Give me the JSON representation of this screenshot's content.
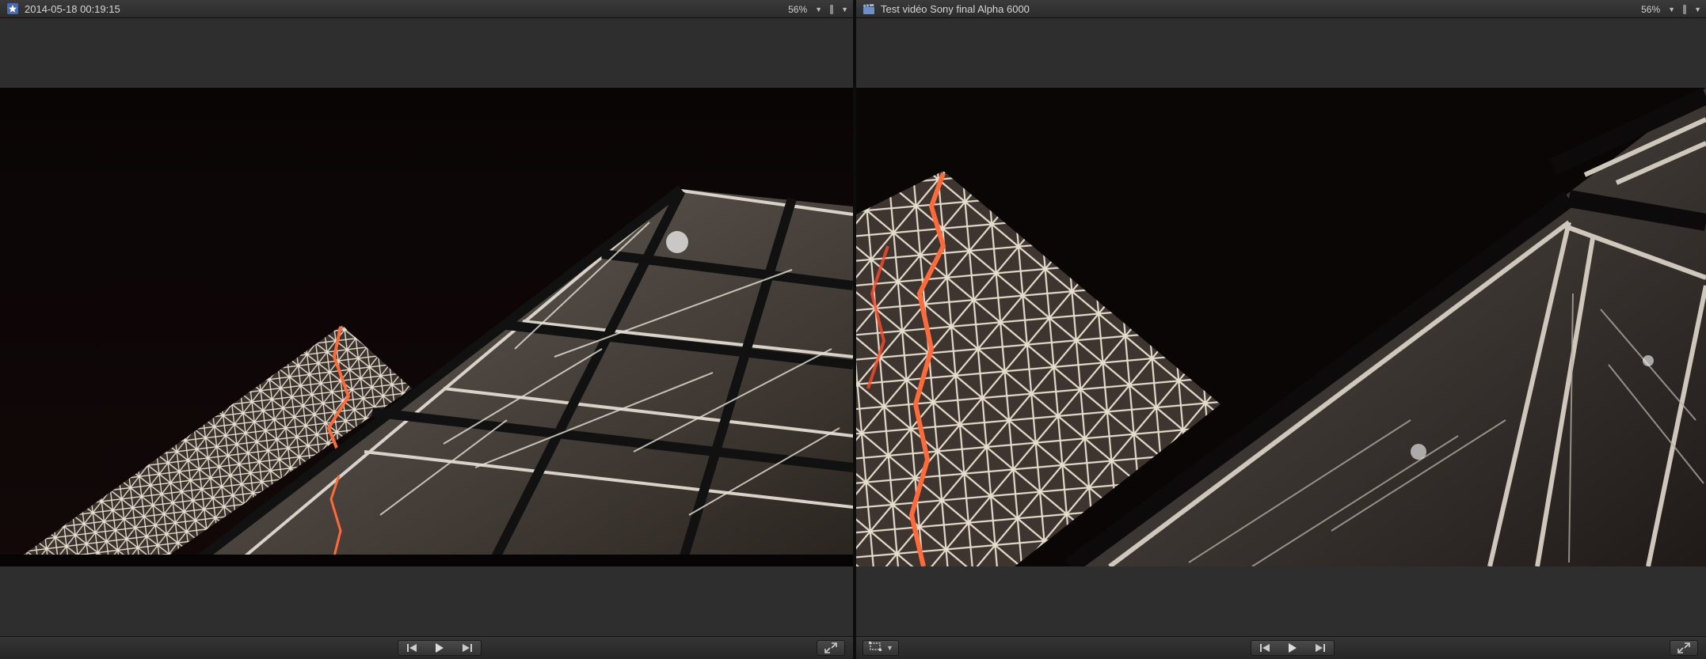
{
  "left_viewer": {
    "title": "2014-05-18 00:19:15",
    "zoom": "56%",
    "icon": "event-star-icon"
  },
  "right_viewer": {
    "title": "Test vidéo Sony  final Alpha 6000",
    "zoom": "56%",
    "icon": "project-clapper-icon"
  },
  "controls": {
    "prev_icon": "skip-back-icon",
    "play_icon": "play-icon",
    "next_icon": "skip-forward-icon",
    "fullscreen_icon": "fullscreen-icon",
    "crop_icon": "transform-icon"
  },
  "colors": {
    "panel": "#2e2e2e",
    "titlebar": "#333333",
    "video_bg": "#050303",
    "glass_frame": "#d8d2c8",
    "neon_red": "#ff5a3a"
  }
}
